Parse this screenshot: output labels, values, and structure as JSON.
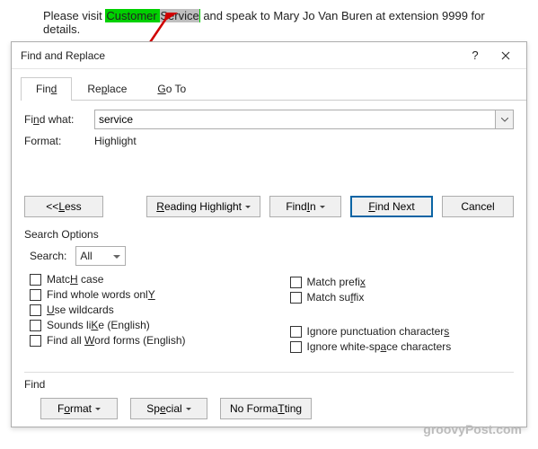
{
  "document": {
    "prefix": "Please visit ",
    "highlight_word1": "Customer ",
    "highlight_word2": "Service",
    "suffix": " and speak to Mary Jo Van Buren at extension 9999 for details."
  },
  "dialog": {
    "title": "Find and Replace",
    "help": "?",
    "tabs": {
      "find": "Find",
      "findU": "d",
      "replace": "Replace",
      "replaceU": "p",
      "goto": "Go To",
      "gotoU": "G"
    },
    "find_what_label": "Find what:",
    "find_what_labelU": "n",
    "find_what_value": "service",
    "format_label": "Format:",
    "format_value": "Highlight",
    "buttons": {
      "less": "<< Less",
      "lessU": "L",
      "reading": "Reading Highlight",
      "readingU": "R",
      "findin": "Find In",
      "findinU": "I",
      "findnext": "Find Next",
      "findnextU": "F",
      "cancel": "Cancel"
    },
    "search_options_label": "Search Options",
    "search_label": "Search",
    "search_labelSuffix": ":",
    "search_value": "All",
    "checkboxes": {
      "match_case": "Match case",
      "match_caseU": "H",
      "whole_words": "Find whole words only",
      "whole_wordsU": "Y",
      "wildcards": "Use wildcards",
      "wildcardsU": "U",
      "sounds_like": "Sounds like (English)",
      "sounds_likeU": "K",
      "all_forms": "Find all word forms (English)",
      "all_formsU": "W",
      "prefix": "Match prefix",
      "prefixU": "x",
      "suffix": "Match suffix",
      "suffixU": "f",
      "ignore_punct": "Ignore punctuation characters",
      "ignore_punctU": "s",
      "ignore_ws": "Ignore white-space characters",
      "ignore_wsU": "a"
    },
    "find_section_label": "Find",
    "bottom_buttons": {
      "format": "Format",
      "formatU": "o",
      "special": "Special",
      "specialU": "e",
      "no_formatting": "No Formatting",
      "no_formattingU": "T"
    }
  },
  "watermark": "groovyPost.com"
}
